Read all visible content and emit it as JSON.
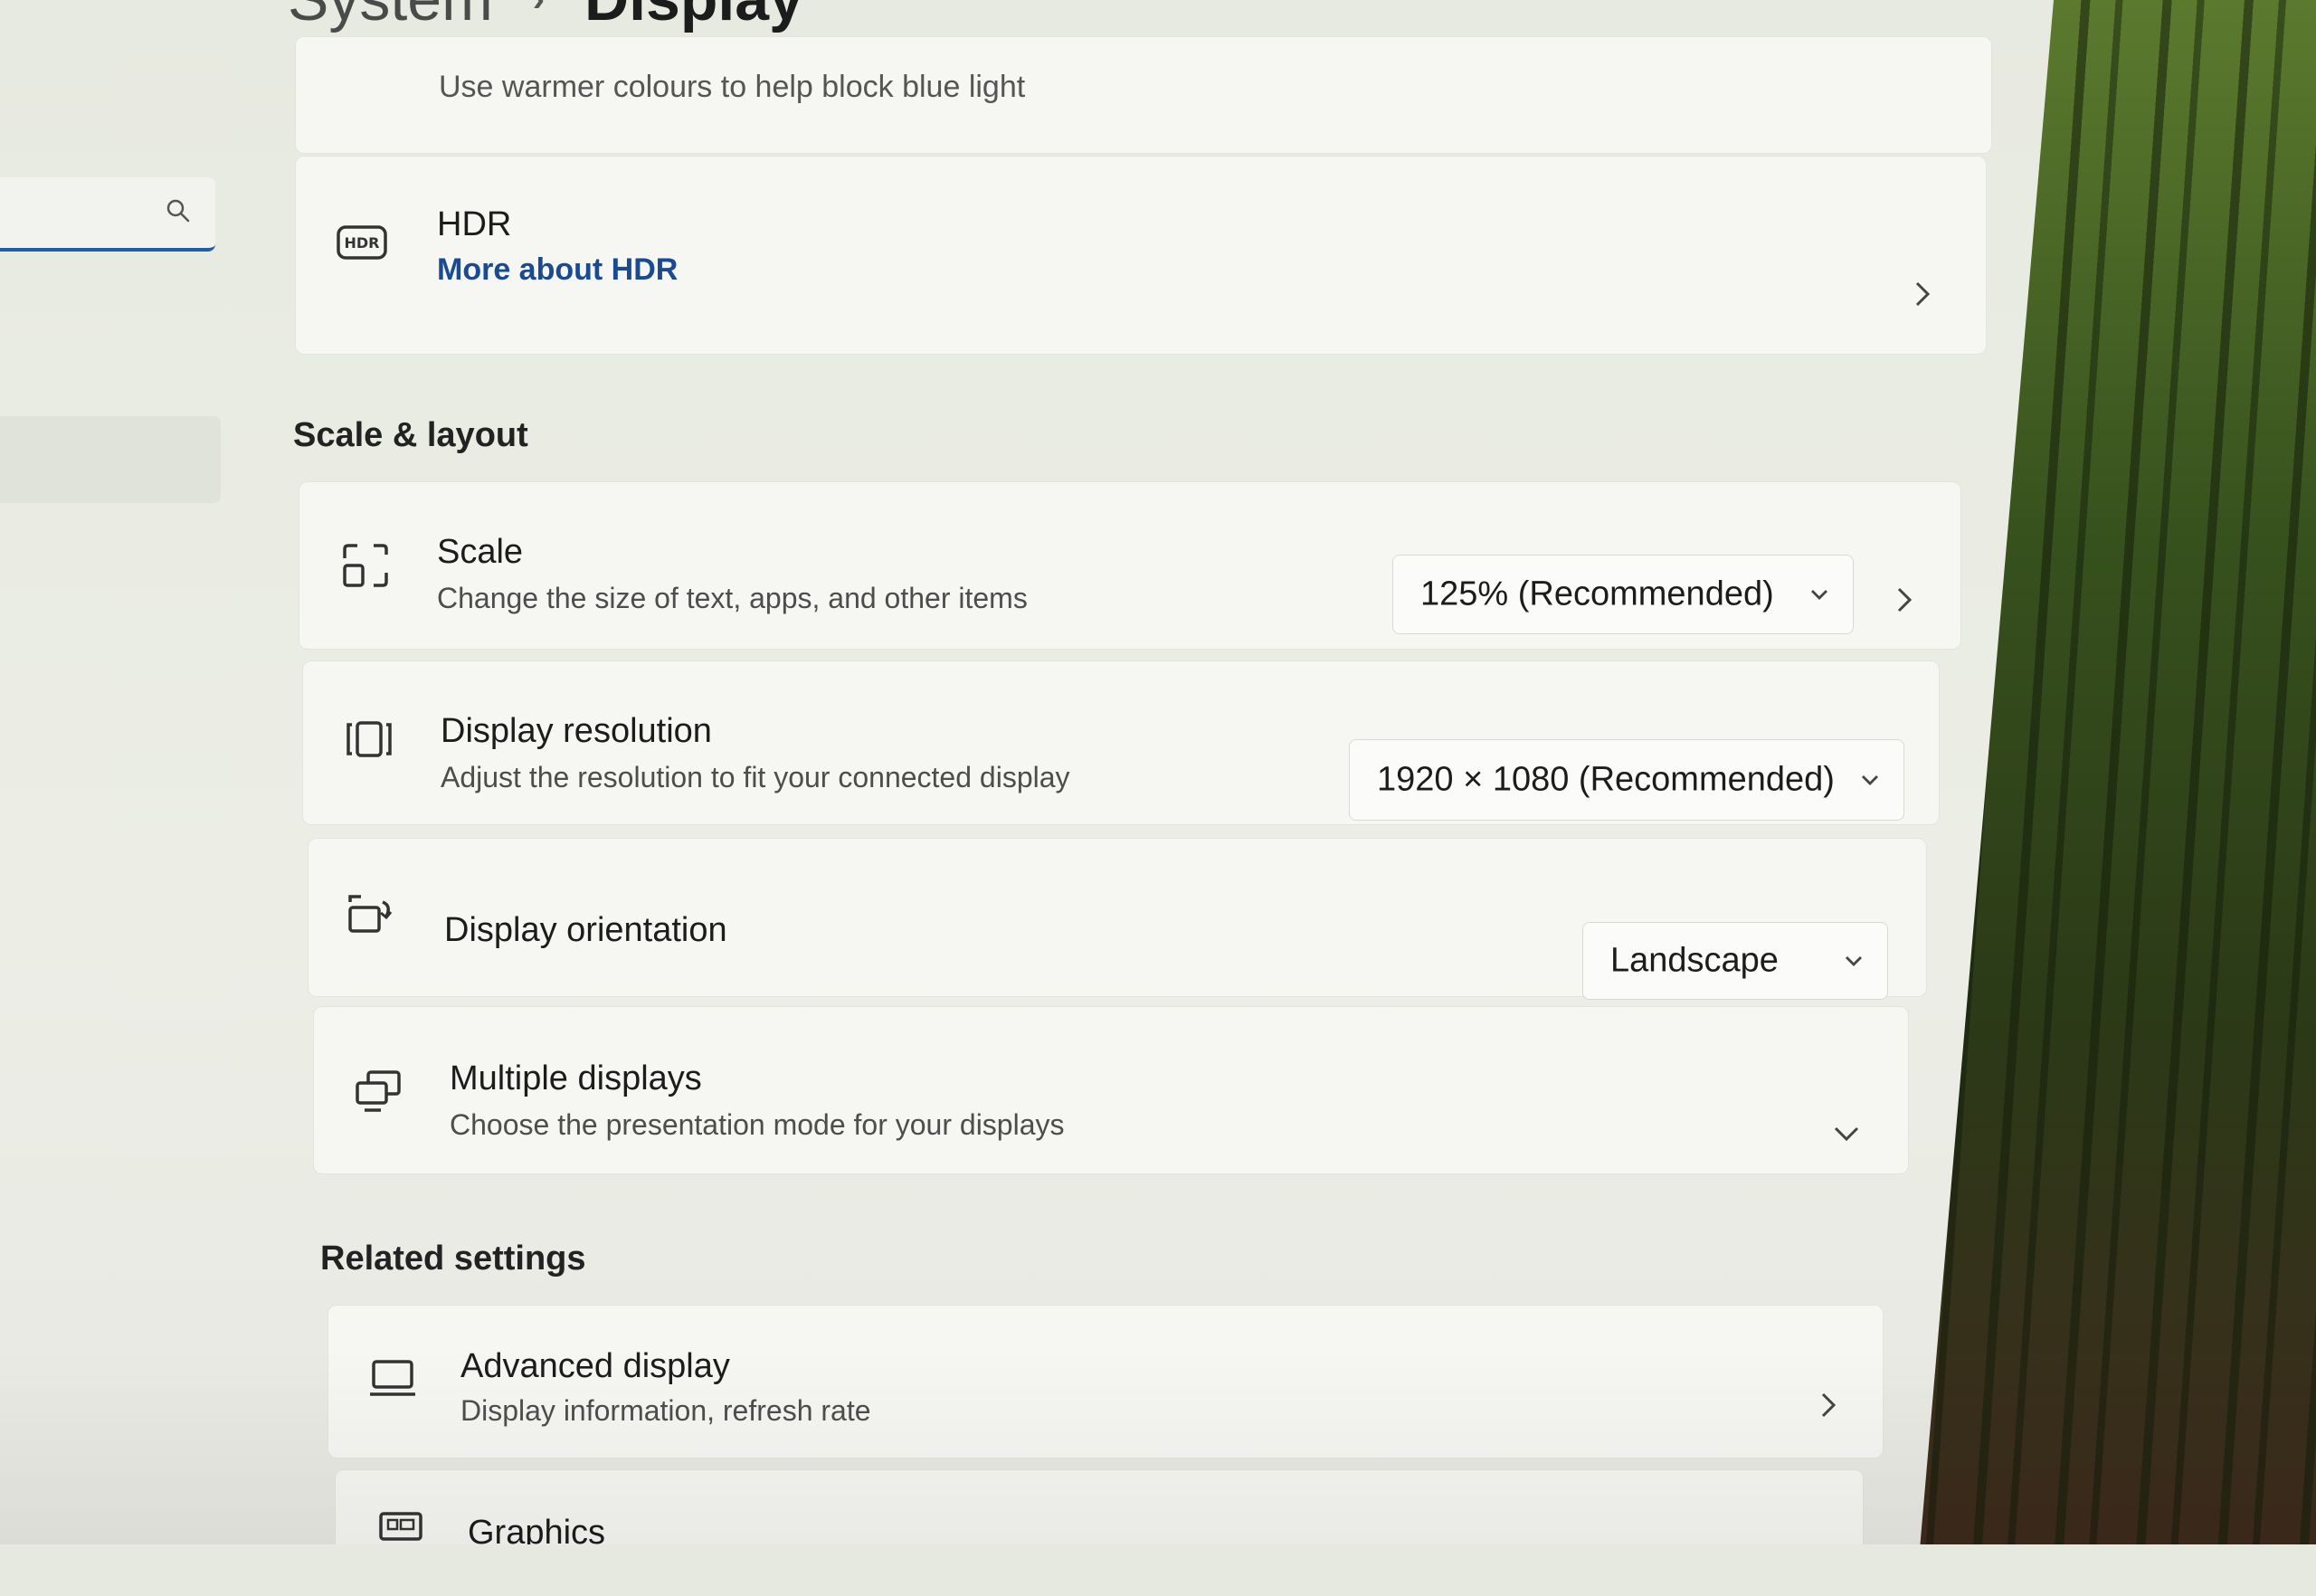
{
  "breadcrumb": {
    "parent": "System",
    "separator": "›",
    "current": "Display"
  },
  "search": {
    "placeholder": "",
    "icon": "search-icon"
  },
  "night_light_card": {
    "subtitle": "Use warmer colours to help block blue light"
  },
  "hdr_card": {
    "title": "HDR",
    "link": "More about HDR",
    "icon": "hdr-icon"
  },
  "scale_layout": {
    "header": "Scale & layout",
    "scale": {
      "title": "Scale",
      "subtitle": "Change the size of text, apps, and other items",
      "value": "125% (Recommended)",
      "icon": "scale-icon"
    },
    "resolution": {
      "title": "Display resolution",
      "subtitle": "Adjust the resolution to fit your connected display",
      "value": "1920 × 1080 (Recommended)",
      "icon": "resolution-icon"
    },
    "orientation": {
      "title": "Display orientation",
      "value": "Landscape",
      "icon": "orientation-icon"
    },
    "multiple": {
      "title": "Multiple displays",
      "subtitle": "Choose the presentation mode for your displays",
      "icon": "multiple-displays-icon"
    }
  },
  "related": {
    "header": "Related settings",
    "advanced": {
      "title": "Advanced display",
      "subtitle": "Display information, refresh rate",
      "icon": "monitor-icon"
    },
    "graphics": {
      "title": "Graphics",
      "icon": "graphics-card-icon"
    }
  },
  "colors": {
    "accent": "#1e5fa8",
    "link": "#1a4a92"
  }
}
